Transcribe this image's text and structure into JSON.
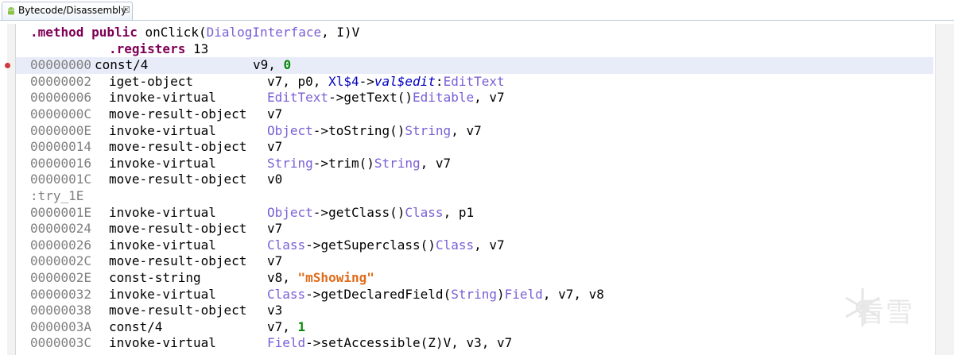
{
  "tab": {
    "title": "Bytecode/Disassembly",
    "close": "☒",
    "icon": "android-icon"
  },
  "header": {
    "directive": ".method",
    "modifier": "public",
    "method_name": "onClick",
    "param_type": "DialogInterface",
    "rest": ", I)V",
    "registers_label": ".registers",
    "registers_value": "13"
  },
  "rows": [
    {
      "addr": "00000000",
      "op": "const/4",
      "a1": "v9, ",
      "num": "0",
      "bp": true
    },
    {
      "addr": "00000002",
      "op": "iget-object",
      "a1": "v7, p0, ",
      "cls": "Xl$4",
      "arrow": "->",
      "fld": "val$edit",
      "colon": ":",
      "type": "EditText"
    },
    {
      "addr": "00000006",
      "op": "invoke-virtual",
      "t1": "EditText",
      "m": "->getText()",
      "t2": "Editable",
      "tail": ", v7"
    },
    {
      "addr": "0000000C",
      "op": "move-result-object",
      "a1": "v7"
    },
    {
      "addr": "0000000E",
      "op": "invoke-virtual",
      "t1": "Object",
      "m": "->toString()",
      "t2": "String",
      "tail": ", v7"
    },
    {
      "addr": "00000014",
      "op": "move-result-object",
      "a1": "v7"
    },
    {
      "addr": "00000016",
      "op": "invoke-virtual",
      "t1": "String",
      "m": "->trim()",
      "t2": "String",
      "tail": ", v7"
    },
    {
      "addr": "0000001C",
      "op": "move-result-object",
      "a1": "v0"
    },
    {
      "label": ":try_1E"
    },
    {
      "addr": "0000001E",
      "op": "invoke-virtual",
      "t1": "Object",
      "m": "->getClass()",
      "t2": "Class",
      "tail": ", p1"
    },
    {
      "addr": "00000024",
      "op": "move-result-object",
      "a1": "v7"
    },
    {
      "addr": "00000026",
      "op": "invoke-virtual",
      "t1": "Class",
      "m": "->getSuperclass()",
      "t2": "Class",
      "tail": ", v7"
    },
    {
      "addr": "0000002C",
      "op": "move-result-object",
      "a1": "v7"
    },
    {
      "addr": "0000002E",
      "op": "const-string",
      "a1": "v8, ",
      "str": "\"mShowing\""
    },
    {
      "addr": "00000032",
      "op": "invoke-virtual",
      "t1": "Class",
      "m": "->getDeclaredField(",
      "targ": "String",
      "m2": ")",
      "t2": "Field",
      "tail": ", v7, v8"
    },
    {
      "addr": "00000038",
      "op": "move-result-object",
      "a1": "v3"
    },
    {
      "addr": "0000003A",
      "op": "const/4",
      "a1": "v7, ",
      "num": "1"
    },
    {
      "addr": "0000003C",
      "op": "invoke-virtual",
      "t1": "Field",
      "m": "->setAccessible(Z)V, v3, v7"
    }
  ],
  "watermark": {
    "text": "看雪",
    "icon": "snowflake-icon"
  },
  "colors": {
    "highlight": "#e8ecf9",
    "breakpoint": "#d23a3a",
    "type": "#7a5fd6",
    "string": "#e06b1b",
    "number": "#098a09"
  }
}
